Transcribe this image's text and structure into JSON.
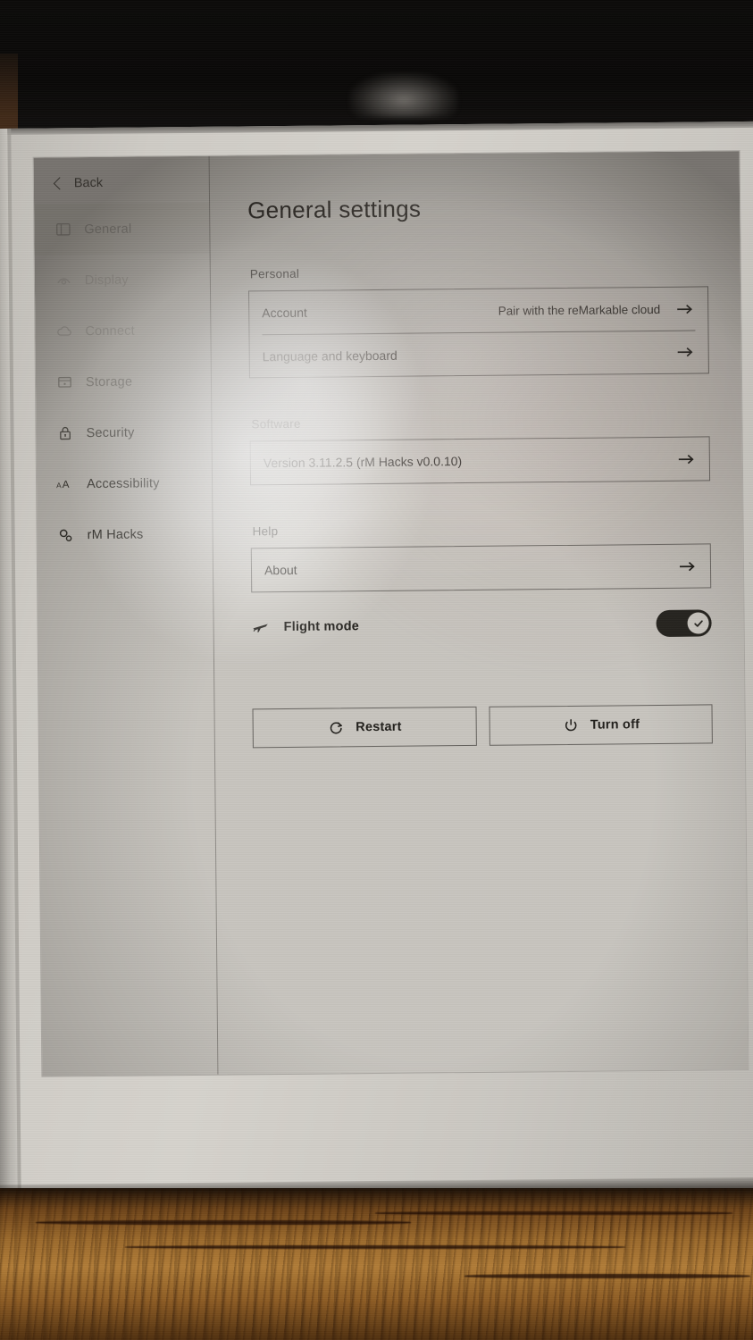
{
  "device": {
    "kind": "e-ink-tablet",
    "screen_note": "reMarkable settings screen photographed on a wooden desk"
  },
  "sidebar": {
    "back": {
      "label": "Back",
      "icon": "chevron-left-icon"
    },
    "items": [
      {
        "label": "General",
        "icon": "sliders-icon",
        "selected": true,
        "obscured": true
      },
      {
        "label": "Display",
        "icon": "display-icon",
        "selected": false,
        "obscured": true
      },
      {
        "label": "Connect",
        "icon": "cloud-icon",
        "selected": false,
        "obscured": true
      },
      {
        "label": "Storage",
        "icon": "storage-icon",
        "selected": false,
        "obscured": true
      },
      {
        "label": "Security",
        "icon": "lock-icon",
        "selected": false,
        "obscured": false
      },
      {
        "label": "Accessibility",
        "icon": "text-size-icon",
        "selected": false,
        "obscured": false
      },
      {
        "label": "rM Hacks",
        "icon": "gears-icon",
        "selected": false,
        "obscured": false
      }
    ]
  },
  "main": {
    "title": "General settings",
    "sections": [
      {
        "label": "Personal",
        "rows": [
          {
            "label": "Account",
            "value": "Pair with the reMarkable cloud",
            "icon": "arrow-right-icon"
          },
          {
            "label": "Language and keyboard",
            "value": "",
            "icon": "arrow-right-icon"
          }
        ]
      },
      {
        "label": "Software",
        "rows": [
          {
            "label": "Version 3.11.2.5 (rM Hacks v0.0.10)",
            "value": "",
            "icon": "arrow-right-icon"
          }
        ]
      },
      {
        "label": "Help",
        "rows": [
          {
            "label": "About",
            "value": "",
            "icon": "arrow-right-icon"
          }
        ]
      }
    ],
    "flight_mode": {
      "label": "Flight mode",
      "icon": "airplane-icon",
      "enabled": true,
      "toggle_icon": "check-icon"
    },
    "buttons": [
      {
        "label": "Restart",
        "icon": "restart-icon"
      },
      {
        "label": "Turn off",
        "icon": "power-icon"
      }
    ]
  }
}
